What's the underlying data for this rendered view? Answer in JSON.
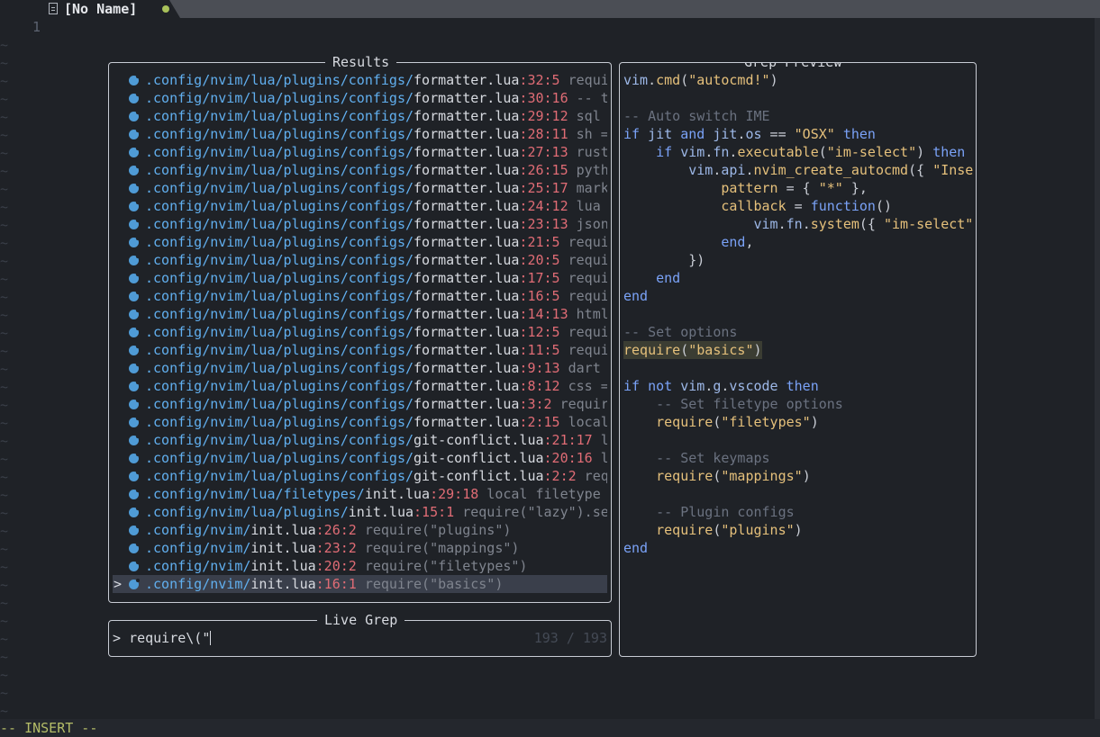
{
  "tab": {
    "name": "[No Name]",
    "file_icon": "file-icon",
    "modified_dot_color": "#a8c15a"
  },
  "buffer": {
    "line_number": "1",
    "filler": "~"
  },
  "results": {
    "title": "Results",
    "rows": [
      {
        "dir": ".config/nvim/lua/plugins/configs/",
        "file": "formatter.lua",
        "pos": ":32:5",
        "snippet": " requi"
      },
      {
        "dir": ".config/nvim/lua/plugins/configs/",
        "file": "formatter.lua",
        "pos": ":30:16",
        "snippet": " -- t"
      },
      {
        "dir": ".config/nvim/lua/plugins/configs/",
        "file": "formatter.lua",
        "pos": ":29:12",
        "snippet": " sql"
      },
      {
        "dir": ".config/nvim/lua/plugins/configs/",
        "file": "formatter.lua",
        "pos": ":28:11",
        "snippet": " sh ="
      },
      {
        "dir": ".config/nvim/lua/plugins/configs/",
        "file": "formatter.lua",
        "pos": ":27:13",
        "snippet": " rust"
      },
      {
        "dir": ".config/nvim/lua/plugins/configs/",
        "file": "formatter.lua",
        "pos": ":26:15",
        "snippet": " pyth"
      },
      {
        "dir": ".config/nvim/lua/plugins/configs/",
        "file": "formatter.lua",
        "pos": ":25:17",
        "snippet": " mark"
      },
      {
        "dir": ".config/nvim/lua/plugins/configs/",
        "file": "formatter.lua",
        "pos": ":24:12",
        "snippet": " lua"
      },
      {
        "dir": ".config/nvim/lua/plugins/configs/",
        "file": "formatter.lua",
        "pos": ":23:13",
        "snippet": " json"
      },
      {
        "dir": ".config/nvim/lua/plugins/configs/",
        "file": "formatter.lua",
        "pos": ":21:5",
        "snippet": " requi"
      },
      {
        "dir": ".config/nvim/lua/plugins/configs/",
        "file": "formatter.lua",
        "pos": ":20:5",
        "snippet": " requi"
      },
      {
        "dir": ".config/nvim/lua/plugins/configs/",
        "file": "formatter.lua",
        "pos": ":17:5",
        "snippet": " requi"
      },
      {
        "dir": ".config/nvim/lua/plugins/configs/",
        "file": "formatter.lua",
        "pos": ":16:5",
        "snippet": " requi"
      },
      {
        "dir": ".config/nvim/lua/plugins/configs/",
        "file": "formatter.lua",
        "pos": ":14:13",
        "snippet": " html"
      },
      {
        "dir": ".config/nvim/lua/plugins/configs/",
        "file": "formatter.lua",
        "pos": ":12:5",
        "snippet": " requi"
      },
      {
        "dir": ".config/nvim/lua/plugins/configs/",
        "file": "formatter.lua",
        "pos": ":11:5",
        "snippet": " requi"
      },
      {
        "dir": ".config/nvim/lua/plugins/configs/",
        "file": "formatter.lua",
        "pos": ":9:13",
        "snippet": " dart"
      },
      {
        "dir": ".config/nvim/lua/plugins/configs/",
        "file": "formatter.lua",
        "pos": ":8:12",
        "snippet": " css ="
      },
      {
        "dir": ".config/nvim/lua/plugins/configs/",
        "file": "formatter.lua",
        "pos": ":3:2",
        "snippet": " requir"
      },
      {
        "dir": ".config/nvim/lua/plugins/configs/",
        "file": "formatter.lua",
        "pos": ":2:15",
        "snippet": " local"
      },
      {
        "dir": ".config/nvim/lua/plugins/configs/",
        "file": "git-conflict.lua",
        "pos": ":21:17",
        "snippet": " l"
      },
      {
        "dir": ".config/nvim/lua/plugins/configs/",
        "file": "git-conflict.lua",
        "pos": ":20:16",
        "snippet": " l"
      },
      {
        "dir": ".config/nvim/lua/plugins/configs/",
        "file": "git-conflict.lua",
        "pos": ":2:2",
        "snippet": " req"
      },
      {
        "dir": ".config/nvim/lua/filetypes/",
        "file": "init.lua",
        "pos": ":29:18",
        "snippet": " local filetype"
      },
      {
        "dir": ".config/nvim/lua/plugins/",
        "file": "init.lua",
        "pos": ":15:1",
        "snippet": " require(\"lazy\").se"
      },
      {
        "dir": ".config/nvim/",
        "file": "init.lua",
        "pos": ":26:2",
        "snippet": " require(\"plugins\")"
      },
      {
        "dir": ".config/nvim/",
        "file": "init.lua",
        "pos": ":23:2",
        "snippet": " require(\"mappings\")"
      },
      {
        "dir": ".config/nvim/",
        "file": "init.lua",
        "pos": ":20:2",
        "snippet": " require(\"filetypes\")"
      },
      {
        "dir": ".config/nvim/",
        "file": "init.lua",
        "pos": ":16:1",
        "snippet": " require(\"basics\")",
        "selected": true
      }
    ],
    "selection_caret": ">",
    "file_icon": "lua-icon"
  },
  "preview": {
    "title": "Grep Preview",
    "lines": [
      "vim.cmd(\"autocmd!\")",
      "",
      "-- Auto switch IME",
      "if jit and jit.os == \"OSX\" then",
      "    if vim.fn.executable(\"im-select\") then",
      "        vim.api.nvim_create_autocmd({ \"Inse",
      "            pattern = { \"*\" },",
      "            callback = function()",
      "                vim.fn.system({ \"im-select\"",
      "            end,",
      "        })",
      "    end",
      "end",
      "",
      "-- Set options",
      "require(\"basics\")",
      "",
      "if not vim.g.vscode then",
      "    -- Set filetype options",
      "    require(\"filetypes\")",
      "",
      "    -- Set keymaps",
      "    require(\"mappings\")",
      "",
      "    -- Plugin configs",
      "    require(\"plugins\")",
      "end"
    ],
    "highlight_line": 15
  },
  "live_grep": {
    "title": "Live Grep",
    "prompt": ">",
    "query": "require\\(\"",
    "count": "193 / 193"
  },
  "status": {
    "mode": "-- INSERT --"
  }
}
